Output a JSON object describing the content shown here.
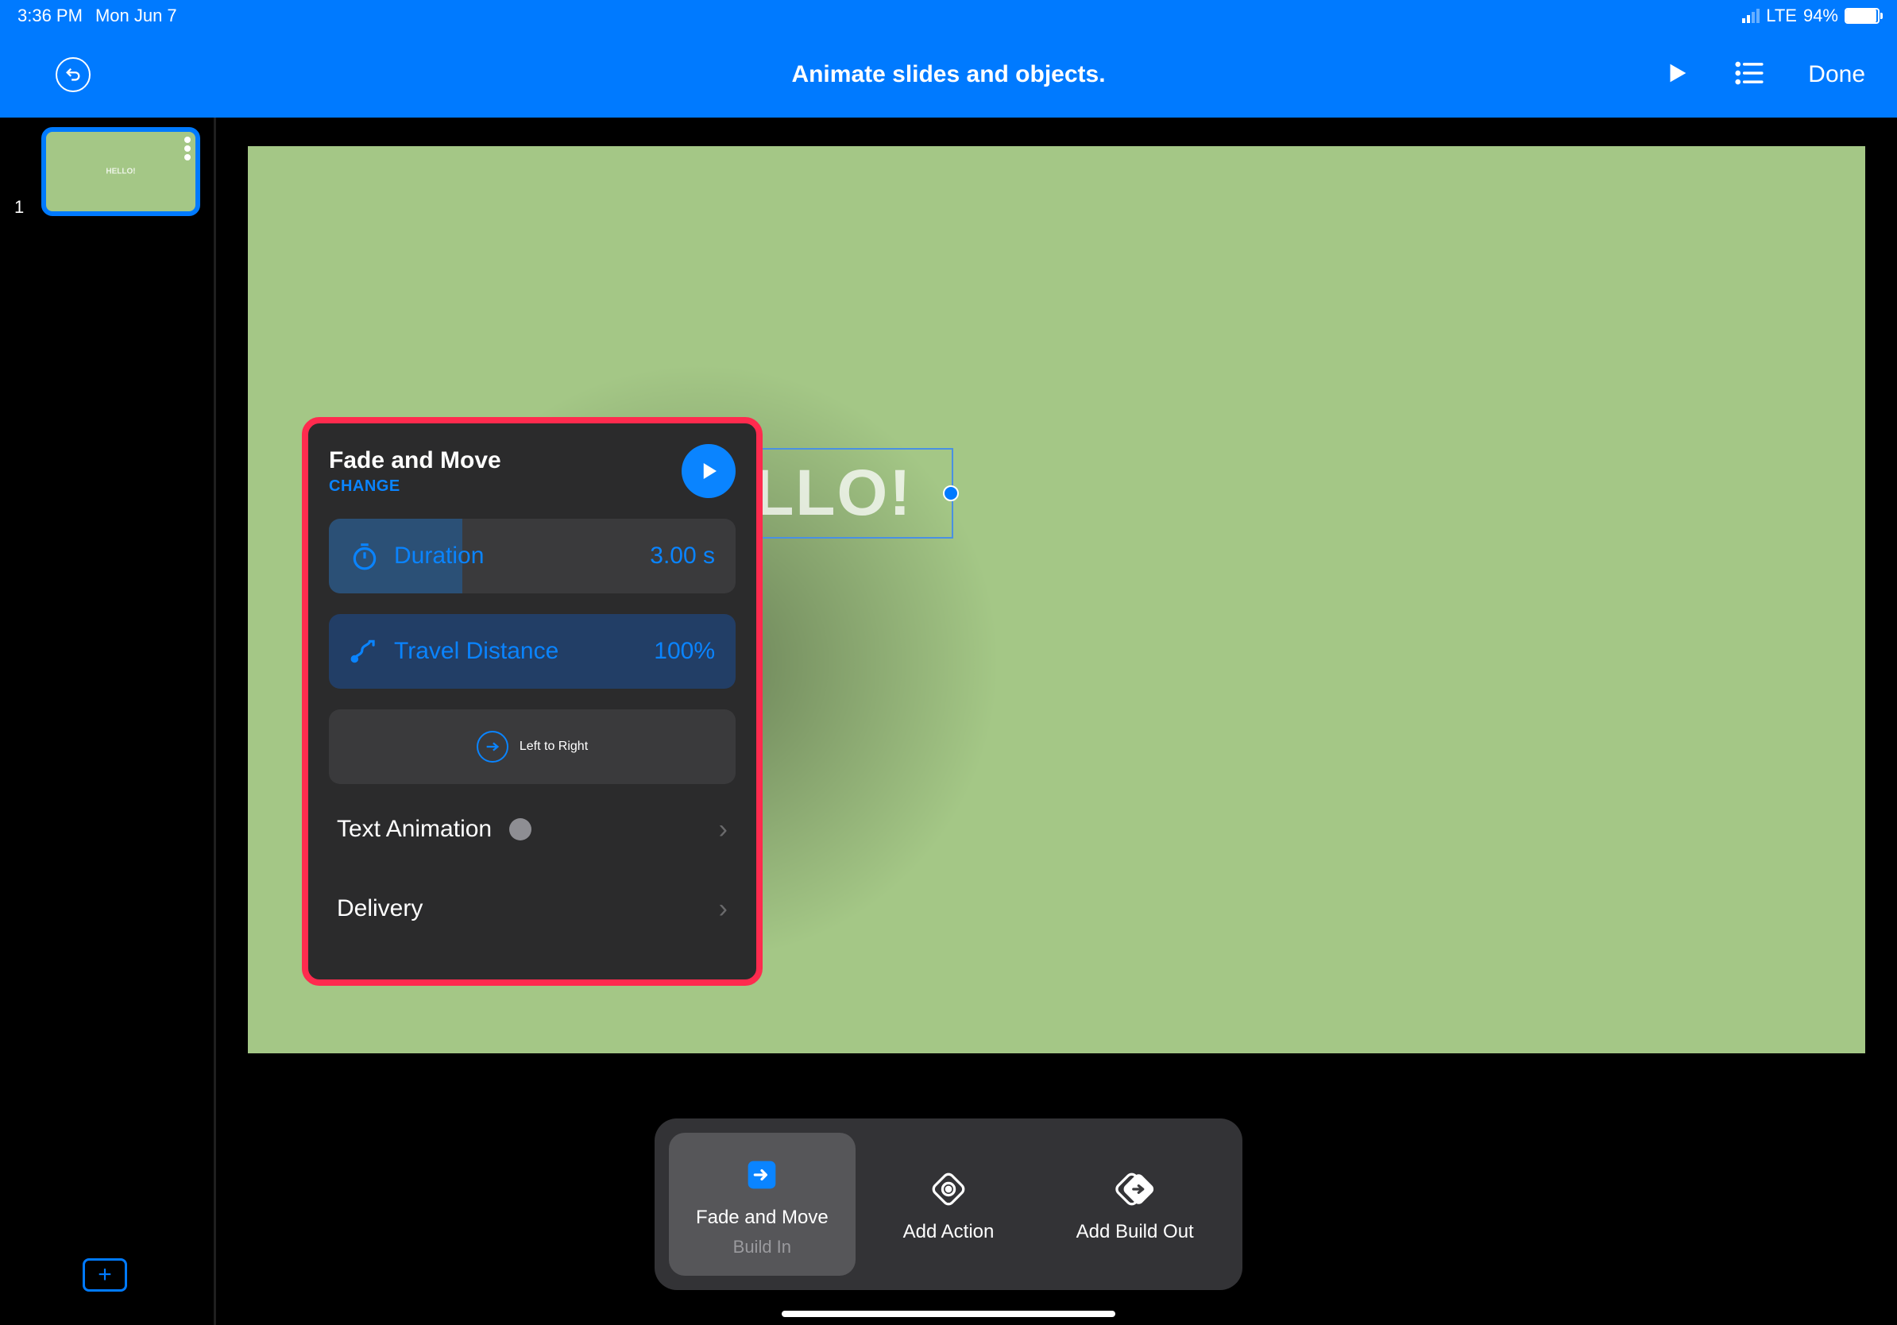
{
  "status": {
    "time": "3:36 PM",
    "date": "Mon Jun 7",
    "network": "LTE",
    "battery": "94%"
  },
  "toolbar": {
    "title": "Animate slides and objects.",
    "done": "Done"
  },
  "sidebar": {
    "slide_index": "1",
    "thumb_text": "HELLO!"
  },
  "slide": {
    "text": "HELLO!"
  },
  "popover": {
    "title": "Fade and Move",
    "change": "CHANGE",
    "duration_label": "Duration",
    "duration_value": "3.00 s",
    "travel_label": "Travel Distance",
    "travel_value": "100%",
    "direction": "Left to Right",
    "text_anim": "Text Animation",
    "delivery": "Delivery"
  },
  "bottom": {
    "item1_label": "Fade and Move",
    "item1_sub": "Build In",
    "item2_label": "Add Action",
    "item3_label": "Add Build Out"
  }
}
